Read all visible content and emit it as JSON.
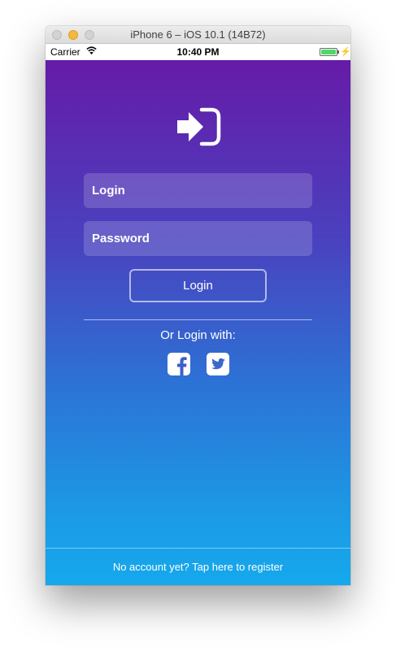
{
  "window": {
    "title": "iPhone 6 – iOS 10.1 (14B72)"
  },
  "status_bar": {
    "carrier": "Carrier",
    "time": "10:40 PM",
    "battery_level": 1.0,
    "wifi_icon": "wifi-icon",
    "charging_icon": "charging-bolt-icon"
  },
  "login_screen": {
    "logo_icon": "sign-in-icon",
    "login_placeholder": "Login",
    "password_placeholder": "Password",
    "login_button_label": "Login",
    "alt_login_text": "Or Login with:",
    "social_icons": [
      "facebook-icon",
      "twitter-icon"
    ],
    "register_text": "No account yet? Tap here to register"
  },
  "colors": {
    "gradient_top": "#661ba8",
    "gradient_bottom": "#15a8ec",
    "text": "#ffffff"
  }
}
